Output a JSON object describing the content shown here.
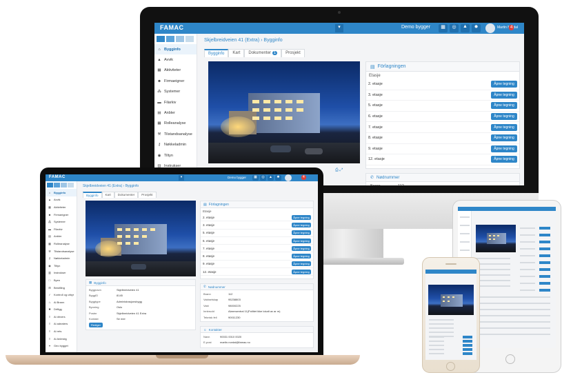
{
  "app": {
    "logo": "FAMAC",
    "building_selector": "Demo bygger",
    "notification_count": "4",
    "user_label": "Martin Nordal"
  },
  "breadcrumb": {
    "path": "Skjelbreidveien 41 (Extra)",
    "separator": "›",
    "current": "Bygginfo"
  },
  "tabs": [
    "Bygginfo",
    "Kart",
    "Dokumenter",
    "Prosjekt"
  ],
  "tab_badge": "1",
  "sidebar": {
    "items": [
      {
        "label": "Bygginfo",
        "icon": "home-icon",
        "active": true
      },
      {
        "label": "Avvik",
        "icon": "warning-icon"
      },
      {
        "label": "Aktiviteter",
        "icon": "calendar-icon"
      },
      {
        "label": "Firmaeigner",
        "icon": "people-icon"
      },
      {
        "label": "Systemer",
        "icon": "network-icon"
      },
      {
        "label": "Filarkiv",
        "icon": "folder-icon"
      },
      {
        "label": "Anbler",
        "icon": "document-icon"
      },
      {
        "label": "Rolleanalyse",
        "icon": "calendar-icon"
      },
      {
        "label": "Tilstandsanalyse",
        "icon": "wrench-icon"
      },
      {
        "label": "Nøkkeladmin",
        "icon": "key-icon"
      },
      {
        "label": "Tiltyn",
        "icon": "eye-icon"
      },
      {
        "label": "Instrukser",
        "icon": "book-icon"
      },
      {
        "label": "Byen",
        "icon": "box-icon"
      }
    ],
    "laptop_extra_items": [
      {
        "label": "Bestilling",
        "icon": "cart-icon"
      },
      {
        "label": "Kontroll og utbyr",
        "icon": "check-icon"
      },
      {
        "label": "Ai Brann",
        "icon": "flame-icon"
      },
      {
        "label": "Driftgg",
        "icon": "gear-icon"
      },
      {
        "label": "Ai drivers",
        "icon": "list-icon"
      },
      {
        "label": "Ai adeaters",
        "icon": "list-icon"
      },
      {
        "label": "Ai rets",
        "icon": "list-icon"
      },
      {
        "label": "Ai Anlestig",
        "icon": "list-icon"
      },
      {
        "label": "Geo bygget",
        "icon": "map-icon"
      }
    ]
  },
  "floors_panel": {
    "title": "Förlagningen",
    "column": "Etasje",
    "floors": [
      "2. etasje",
      "3. etasje",
      "5. etasje",
      "6. etasje",
      "7. etasje",
      "8. etasje",
      "9. etasje",
      "12. etasje"
    ],
    "button_label": "Åpne tegning"
  },
  "building_panel": {
    "title": "Bygginfo",
    "rows": [
      {
        "k": "Byggnavn",
        "v": "Skjelbreidveien 41"
      },
      {
        "k": "ByggID",
        "v": "8145"
      },
      {
        "k": "Byggtype",
        "v": "Administrasjonsbygg"
      },
      {
        "k": "Byoning",
        "v": "Oslo"
      },
      {
        "k": "Postnr",
        "v": "Skjelbreidveien 41 Extra"
      },
      {
        "k": "Kontakt",
        "v": "Se mer"
      }
    ],
    "button_label": "Rediger"
  },
  "keys_panel": {
    "title": "Nødnummer",
    "rows": [
      {
        "k": "Brann",
        "v": "112"
      },
      {
        "k": "Vaktselskap",
        "v": "95238803"
      },
      {
        "k": "Vakt",
        "v": "98000225"
      },
      {
        "k": "Innbrudd",
        "v": "Alarmsentral 11(Politiet ikke lokalt av ar m)"
      },
      {
        "k": "Teknisk feil",
        "v": "90011230"
      }
    ]
  },
  "contact_panel": {
    "title": "Kontakter",
    "rows": [
      {
        "k": "Navn",
        "v": "90031 0010 0020"
      },
      {
        "k": "E-post",
        "v": "martin.nordal@famac.no"
      }
    ]
  }
}
